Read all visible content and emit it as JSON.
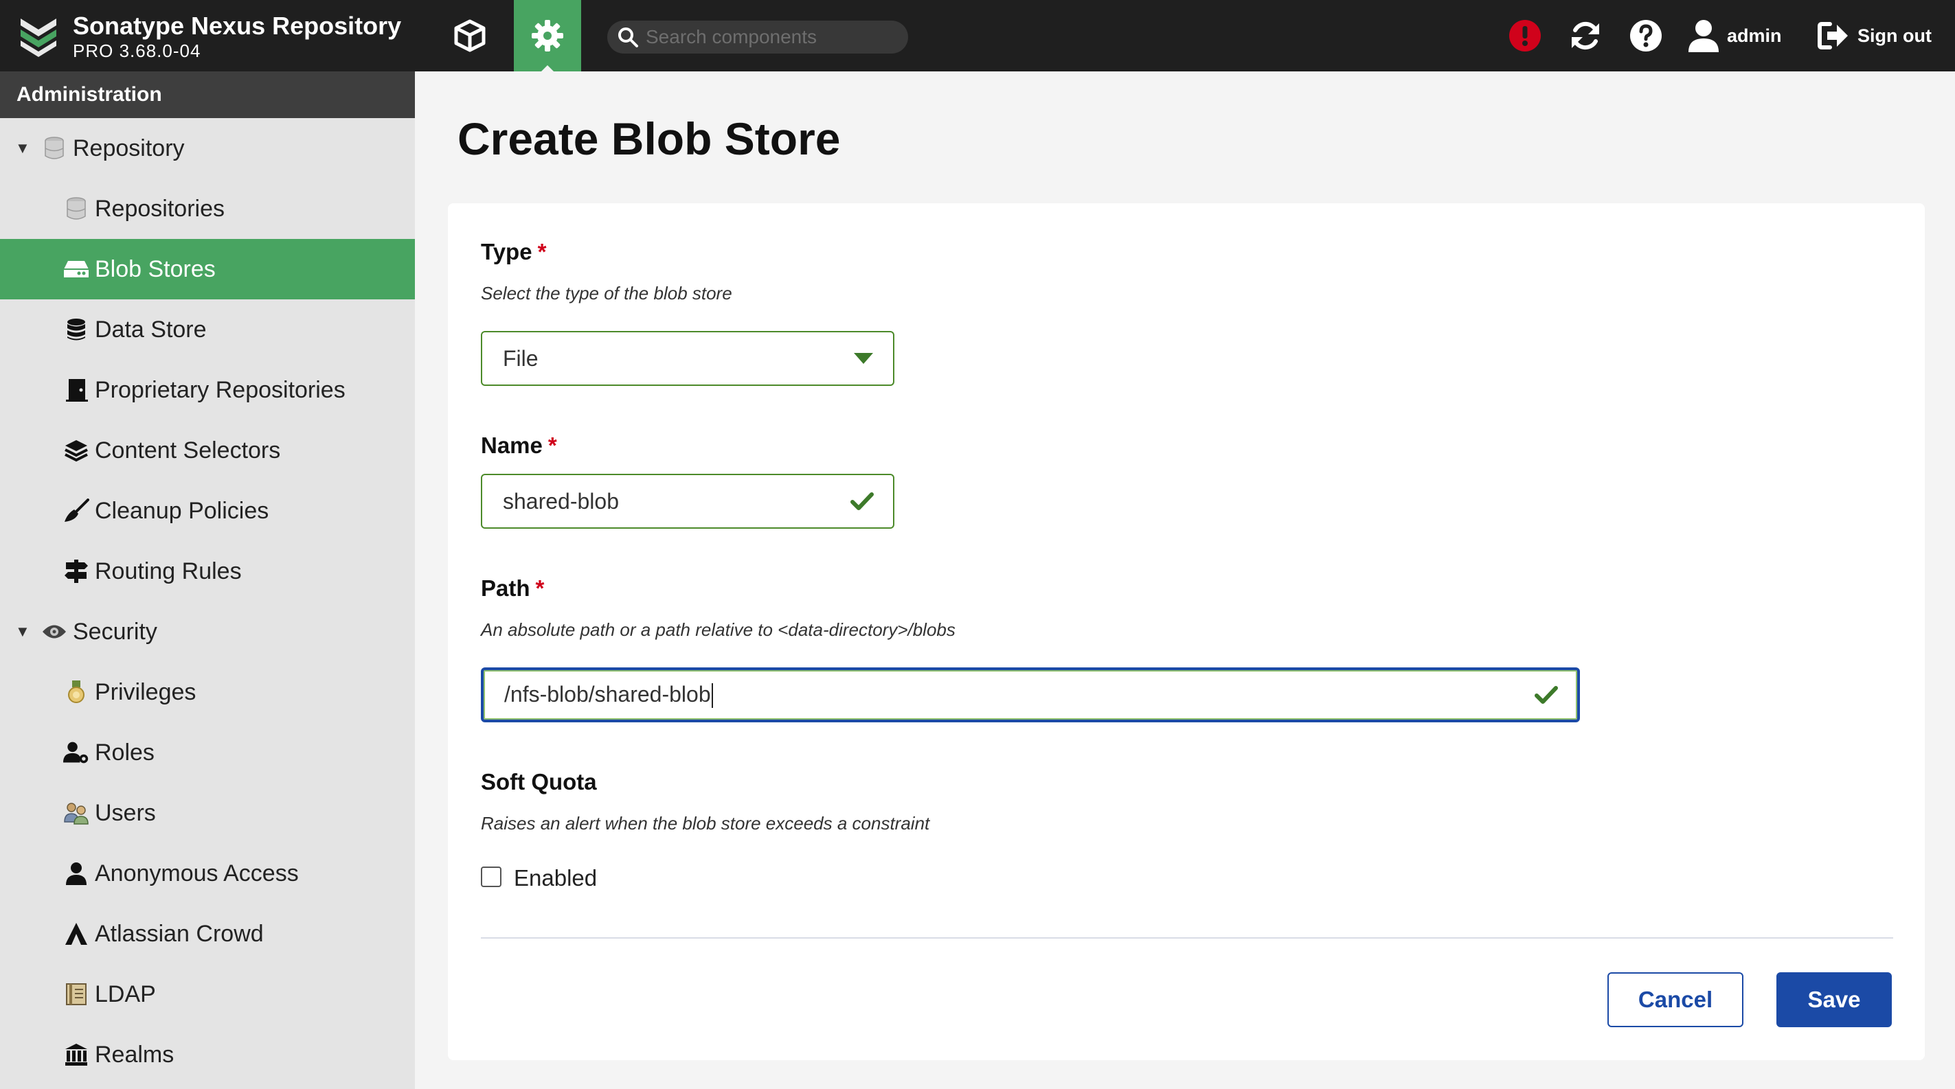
{
  "header": {
    "app_name": "Sonatype Nexus Repository",
    "version": "PRO 3.68.0-04",
    "search_placeholder": "Search components",
    "user_name": "admin",
    "sign_out_label": "Sign out"
  },
  "sidebar": {
    "title": "Administration",
    "items": [
      {
        "label": "Repository",
        "icon": "database-icon",
        "group": true,
        "expanded": true
      },
      {
        "label": "Repositories",
        "icon": "database-icon"
      },
      {
        "label": "Blob Stores",
        "icon": "hard-drive-icon",
        "active": true
      },
      {
        "label": "Data Store",
        "icon": "database-stack-icon"
      },
      {
        "label": "Proprietary Repositories",
        "icon": "door-icon"
      },
      {
        "label": "Content Selectors",
        "icon": "layers-icon"
      },
      {
        "label": "Cleanup Policies",
        "icon": "broom-icon"
      },
      {
        "label": "Routing Rules",
        "icon": "signpost-icon"
      },
      {
        "label": "Security",
        "icon": "eye-icon",
        "group": true,
        "expanded": true
      },
      {
        "label": "Privileges",
        "icon": "medal-icon"
      },
      {
        "label": "Roles",
        "icon": "users-cog-icon"
      },
      {
        "label": "Users",
        "icon": "users-icon"
      },
      {
        "label": "Anonymous Access",
        "icon": "user-icon"
      },
      {
        "label": "Atlassian Crowd",
        "icon": "crowd-icon"
      },
      {
        "label": "LDAP",
        "icon": "book-icon"
      },
      {
        "label": "Realms",
        "icon": "realm-icon"
      }
    ]
  },
  "main": {
    "title": "Create Blob Store",
    "type": {
      "label": "Type",
      "required_mark": "*",
      "description": "Select the type of the blob store",
      "value": "File"
    },
    "name": {
      "label": "Name",
      "required_mark": "*",
      "value": "shared-blob"
    },
    "path": {
      "label": "Path",
      "required_mark": "*",
      "description": "An absolute path or a path relative to <data-directory>/blobs",
      "value": "/nfs-blob/shared-blob"
    },
    "soft_quota": {
      "label": "Soft Quota",
      "description": "Raises an alert when the blob store exceeds a constraint",
      "checkbox_label": "Enabled",
      "checked": false
    },
    "cancel_label": "Cancel",
    "save_label": "Save"
  },
  "colors": {
    "header_bg": "#1f1f1f",
    "accent_green": "#48a461",
    "primary_blue": "#1b4aa6",
    "valid_green": "#4c8a2a",
    "required_red": "#d0021b",
    "alert_red": "#d0021b"
  }
}
